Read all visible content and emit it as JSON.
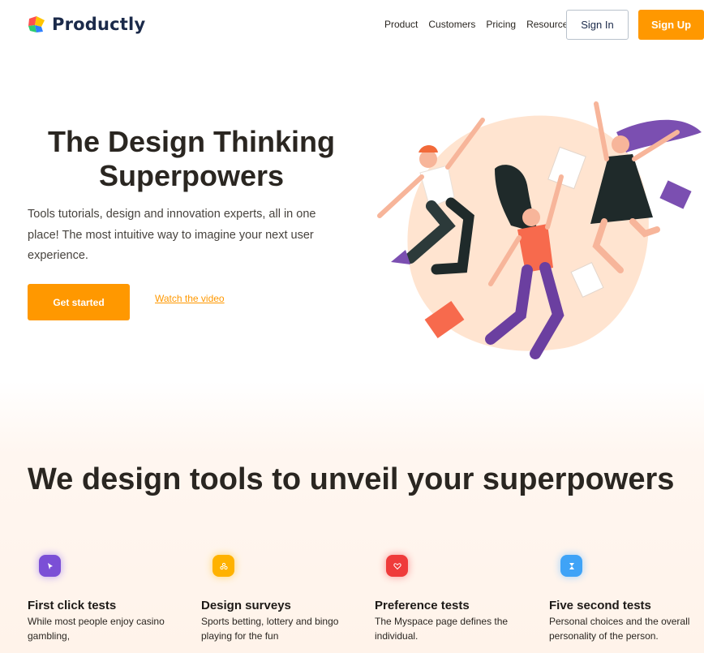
{
  "brand": {
    "name": "Productly"
  },
  "nav": {
    "items": [
      "Product",
      "Customers",
      "Pricing",
      "Resources"
    ]
  },
  "header": {
    "signin_label": "Sign In",
    "signup_label": "Sign Up"
  },
  "hero": {
    "title": "The Design Thinking Superpowers",
    "subtitle": "Tools tutorials, design and innovation experts, all in one place! The most intuitive way to imagine your next user experience.",
    "cta_label": "Get started",
    "video_link": "Watch the video"
  },
  "section": {
    "title": "We design tools to unveil your superpowers",
    "features": [
      {
        "title": "First click tests",
        "desc": "While most people enjoy casino gambling,",
        "icon": "cursor-icon",
        "color": "#7b4fd6"
      },
      {
        "title": "Design surveys",
        "desc": "Sports betting, lottery and bingo playing for the fun",
        "icon": "nodes-icon",
        "color": "#ffb200"
      },
      {
        "title": "Preference tests",
        "desc": "The Myspace page defines the individual.",
        "icon": "heart-icon",
        "color": "#ef3b3b"
      },
      {
        "title": "Five second tests",
        "desc": "Personal choices and the overall personality of the person.",
        "icon": "hourglass-icon",
        "color": "#3fa3f7"
      }
    ]
  },
  "colors": {
    "accent": "#ff9800",
    "brand": "#1b2a4a",
    "text": "#2a2621"
  }
}
